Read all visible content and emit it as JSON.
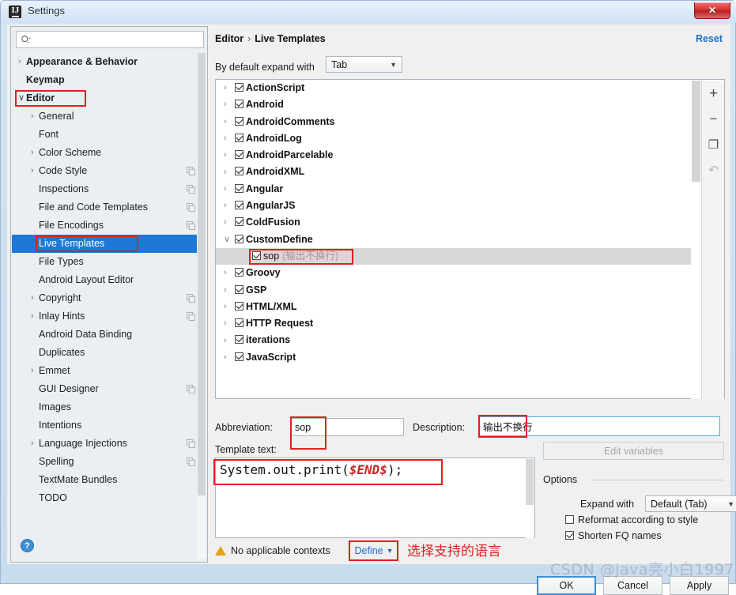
{
  "window": {
    "title": "Settings",
    "app_icon": "intellij-idea-icon",
    "close_label": "✕"
  },
  "sidebar": {
    "search": {
      "placeholder": "",
      "value": "",
      "icon": "search-icon"
    },
    "items": [
      {
        "label": "Appearance & Behavior",
        "arrow": "collapsed",
        "bold": true,
        "indent": 0,
        "copy": false,
        "selected": false
      },
      {
        "label": "Keymap",
        "arrow": "none",
        "bold": true,
        "indent": 0,
        "copy": false,
        "selected": false
      },
      {
        "label": "Editor",
        "arrow": "expanded",
        "bold": true,
        "indent": 0,
        "copy": false,
        "selected": false,
        "highlight": true
      },
      {
        "label": "General",
        "arrow": "collapsed",
        "bold": false,
        "indent": 1,
        "copy": false,
        "selected": false
      },
      {
        "label": "Font",
        "arrow": "none",
        "bold": false,
        "indent": 1,
        "copy": false,
        "selected": false
      },
      {
        "label": "Color Scheme",
        "arrow": "collapsed",
        "bold": false,
        "indent": 1,
        "copy": false,
        "selected": false
      },
      {
        "label": "Code Style",
        "arrow": "collapsed",
        "bold": false,
        "indent": 1,
        "copy": true,
        "selected": false
      },
      {
        "label": "Inspections",
        "arrow": "none",
        "bold": false,
        "indent": 1,
        "copy": true,
        "selected": false
      },
      {
        "label": "File and Code Templates",
        "arrow": "none",
        "bold": false,
        "indent": 1,
        "copy": true,
        "selected": false
      },
      {
        "label": "File Encodings",
        "arrow": "none",
        "bold": false,
        "indent": 1,
        "copy": true,
        "selected": false
      },
      {
        "label": "Live Templates",
        "arrow": "none",
        "bold": false,
        "indent": 1,
        "copy": false,
        "selected": true,
        "highlight": true
      },
      {
        "label": "File Types",
        "arrow": "none",
        "bold": false,
        "indent": 1,
        "copy": false,
        "selected": false
      },
      {
        "label": "Android Layout Editor",
        "arrow": "none",
        "bold": false,
        "indent": 1,
        "copy": false,
        "selected": false
      },
      {
        "label": "Copyright",
        "arrow": "collapsed",
        "bold": false,
        "indent": 1,
        "copy": true,
        "selected": false
      },
      {
        "label": "Inlay Hints",
        "arrow": "collapsed",
        "bold": false,
        "indent": 1,
        "copy": true,
        "selected": false
      },
      {
        "label": "Android Data Binding",
        "arrow": "none",
        "bold": false,
        "indent": 1,
        "copy": false,
        "selected": false
      },
      {
        "label": "Duplicates",
        "arrow": "none",
        "bold": false,
        "indent": 1,
        "copy": false,
        "selected": false
      },
      {
        "label": "Emmet",
        "arrow": "collapsed",
        "bold": false,
        "indent": 1,
        "copy": false,
        "selected": false
      },
      {
        "label": "GUI Designer",
        "arrow": "none",
        "bold": false,
        "indent": 1,
        "copy": true,
        "selected": false
      },
      {
        "label": "Images",
        "arrow": "none",
        "bold": false,
        "indent": 1,
        "copy": false,
        "selected": false
      },
      {
        "label": "Intentions",
        "arrow": "none",
        "bold": false,
        "indent": 1,
        "copy": false,
        "selected": false
      },
      {
        "label": "Language Injections",
        "arrow": "collapsed",
        "bold": false,
        "indent": 1,
        "copy": true,
        "selected": false
      },
      {
        "label": "Spelling",
        "arrow": "none",
        "bold": false,
        "indent": 1,
        "copy": true,
        "selected": false
      },
      {
        "label": "TextMate Bundles",
        "arrow": "none",
        "bold": false,
        "indent": 1,
        "copy": false,
        "selected": false
      },
      {
        "label": "TODO",
        "arrow": "none",
        "bold": false,
        "indent": 1,
        "copy": false,
        "selected": false
      }
    ],
    "help_label": "?"
  },
  "main": {
    "breadcrumb": {
      "parent": "Editor",
      "separator": "›",
      "current": "Live Templates"
    },
    "reset_label": "Reset",
    "expand_with": {
      "label": "By default expand with",
      "value": "Tab"
    },
    "templates": [
      {
        "name": "ActionScript",
        "arrow": "collapsed",
        "checked": true,
        "child": false
      },
      {
        "name": "Android",
        "arrow": "collapsed",
        "checked": true,
        "child": false
      },
      {
        "name": "AndroidComments",
        "arrow": "collapsed",
        "checked": true,
        "child": false
      },
      {
        "name": "AndroidLog",
        "arrow": "collapsed",
        "checked": true,
        "child": false
      },
      {
        "name": "AndroidParcelable",
        "arrow": "collapsed",
        "checked": true,
        "child": false
      },
      {
        "name": "AndroidXML",
        "arrow": "collapsed",
        "checked": true,
        "child": false
      },
      {
        "name": "Angular",
        "arrow": "collapsed",
        "checked": true,
        "child": false
      },
      {
        "name": "AngularJS",
        "arrow": "collapsed",
        "checked": true,
        "child": false
      },
      {
        "name": "ColdFusion",
        "arrow": "collapsed",
        "checked": true,
        "child": false
      },
      {
        "name": "CustomDefine",
        "arrow": "expanded",
        "checked": true,
        "child": false
      },
      {
        "name": "sop",
        "desc": "(输出不换行)",
        "arrow": "none",
        "checked": true,
        "child": true,
        "selected": true,
        "highlight": true
      },
      {
        "name": "Groovy",
        "arrow": "collapsed",
        "checked": true,
        "child": false
      },
      {
        "name": "GSP",
        "arrow": "collapsed",
        "checked": true,
        "child": false
      },
      {
        "name": "HTML/XML",
        "arrow": "collapsed",
        "checked": true,
        "child": false
      },
      {
        "name": "HTTP Request",
        "arrow": "collapsed",
        "checked": true,
        "child": false
      },
      {
        "name": "iterations",
        "arrow": "collapsed",
        "checked": true,
        "child": false
      },
      {
        "name": "JavaScript",
        "arrow": "collapsed",
        "checked": true,
        "child": false
      }
    ],
    "toolbar": [
      {
        "icon": "plus-icon",
        "glyph": "+"
      },
      {
        "icon": "minus-icon",
        "glyph": "−"
      },
      {
        "icon": "copy-icon",
        "glyph": "❐"
      },
      {
        "icon": "undo-icon",
        "glyph": "↶"
      }
    ],
    "editor": {
      "abbreviation_label": "Abbreviation:",
      "abbreviation_value": "sop",
      "description_label": "Description:",
      "description_value": "输出不换行",
      "template_text_label": "Template text:",
      "template_code_prefix": "System.out.print(",
      "template_code_var": "$END$",
      "template_code_suffix": ");",
      "edit_variables_label": "Edit variables"
    },
    "options": {
      "title": "Options",
      "expand_with_label": "Expand with",
      "expand_with_value": "Default (Tab)",
      "reformat_label": "Reformat according to style",
      "reformat_checked": false,
      "shorten_label": "Shorten FQ names",
      "shorten_checked": true
    },
    "context": {
      "warning_text": "No applicable contexts",
      "define_label": "Define",
      "define_chevron": "⌄",
      "annotation": "选择支持的语言"
    }
  },
  "footer": {
    "ok": "OK",
    "cancel": "Cancel",
    "apply": "Apply",
    "watermark": "CSDN @java亮小白1997"
  },
  "colors": {
    "selection_blue": "#1e79d6",
    "link_blue": "#1a6fc4",
    "annotation_red": "#e02020",
    "variable_red": "#c62828",
    "warning_amber": "#e8a317"
  }
}
